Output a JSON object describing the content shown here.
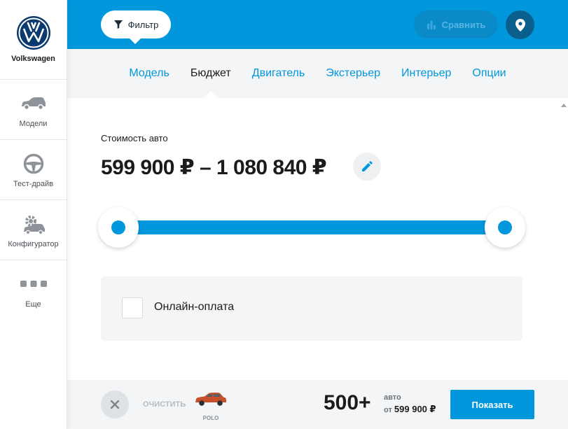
{
  "brand": {
    "name": "Volkswagen"
  },
  "sidebar": {
    "items": [
      {
        "label": "Модели",
        "icon": "car-icon"
      },
      {
        "label": "Тест-драйв",
        "icon": "steering-wheel-icon"
      },
      {
        "label": "Конфигуратор",
        "icon": "configurator-icon"
      },
      {
        "label": "Еще",
        "icon": "more-dots-icon"
      }
    ]
  },
  "topbar": {
    "filter_label": "Фильтр",
    "compare_label": "Сравнить"
  },
  "tabs": [
    "Модель",
    "Бюджет",
    "Двигатель",
    "Экстерьер",
    "Интерьер",
    "Опции"
  ],
  "active_tab": "Бюджет",
  "budget": {
    "label": "Стоимость авто",
    "range": "599 900 ₽ – 1 080 840 ₽"
  },
  "online_payment": {
    "label": "Онлайн-оплата",
    "checked": false
  },
  "bottombar": {
    "clear_label": "ОЧИСТИТЬ",
    "car_name": "POLO",
    "count": "500+",
    "count_unit": "авто",
    "price_prefix": "от",
    "price_from": "599 900 ₽",
    "show_label": "Показать"
  },
  "colors": {
    "accent": "#0097dc",
    "dark": "#1b1b1b",
    "panel": "#f4f5f6"
  }
}
